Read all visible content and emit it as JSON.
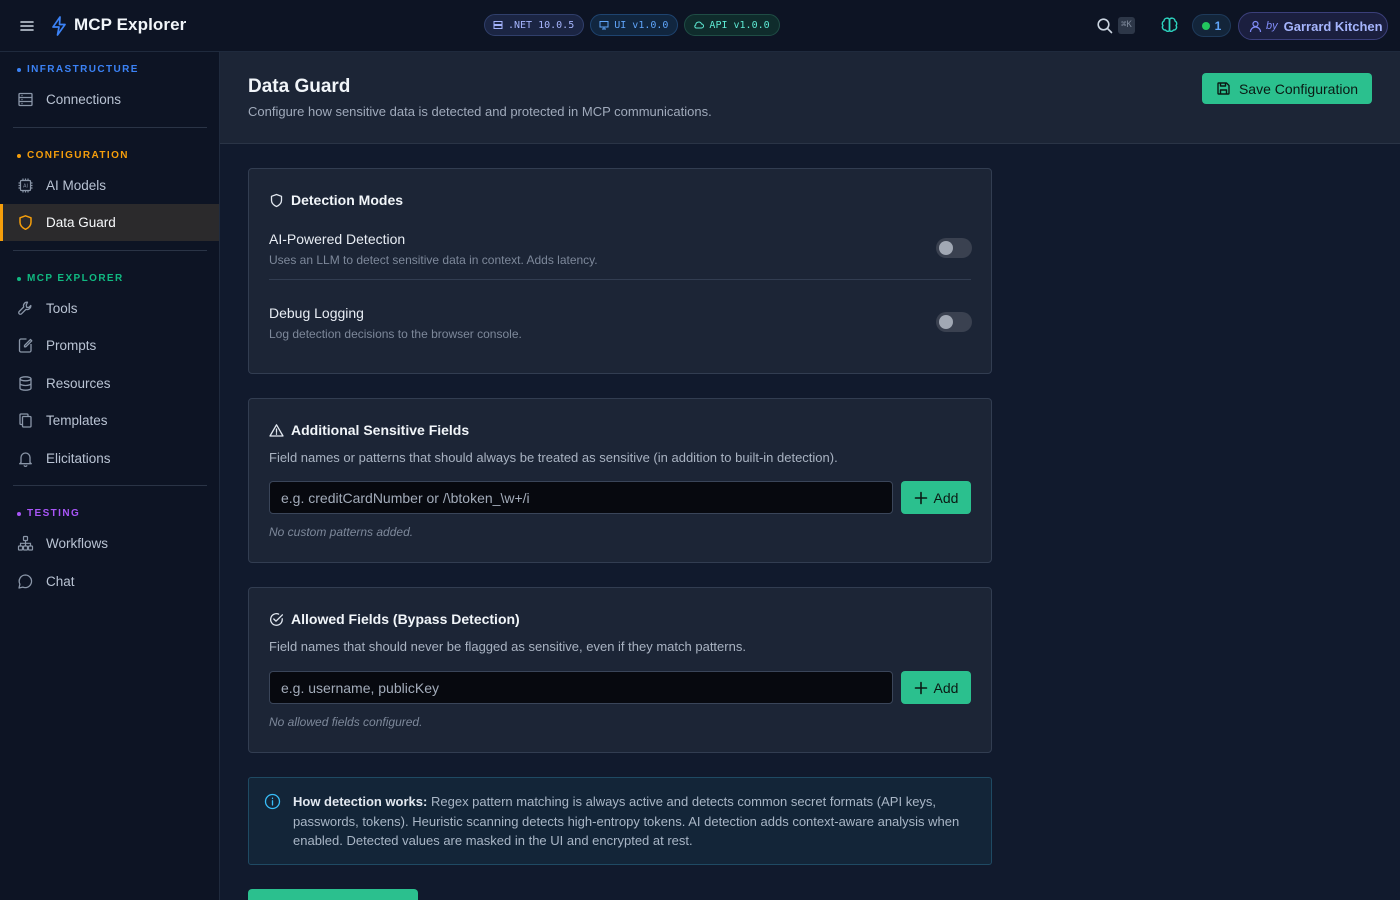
{
  "app": {
    "title": "MCP Explorer",
    "badges": [
      {
        "label": ".NET 10.0.5",
        "icon": "server-icon"
      },
      {
        "label": "UI v1.0.0",
        "icon": "monitor-icon"
      },
      {
        "label": "API v1.0.0",
        "icon": "cloud-icon"
      }
    ],
    "search_shortcut": "⌘K",
    "connection_count": "1",
    "user_prefix": "by",
    "user_name": "Garrard Kitchen"
  },
  "sidebar": {
    "sections": [
      {
        "label": "INFRASTRUCTURE",
        "color": "#3b82f6",
        "items": [
          {
            "label": "Connections",
            "icon": "server-rack-icon"
          }
        ]
      },
      {
        "label": "CONFIGURATION",
        "color": "#f59e0b",
        "items": [
          {
            "label": "AI Models",
            "icon": "chip-icon"
          },
          {
            "label": "Data Guard",
            "icon": "shield-icon",
            "active": true
          }
        ]
      },
      {
        "label": "MCP EXPLORER",
        "color": "#10b981",
        "items": [
          {
            "label": "Tools",
            "icon": "wrench-icon"
          },
          {
            "label": "Prompts",
            "icon": "pencil-note-icon"
          },
          {
            "label": "Resources",
            "icon": "database-icon"
          },
          {
            "label": "Templates",
            "icon": "copy-icon"
          },
          {
            "label": "Elicitations",
            "icon": "bell-icon"
          }
        ]
      },
      {
        "label": "TESTING",
        "color": "#a855f7",
        "items": [
          {
            "label": "Workflows",
            "icon": "workflow-icon"
          },
          {
            "label": "Chat",
            "icon": "chat-icon"
          }
        ]
      }
    ]
  },
  "page": {
    "title": "Data Guard",
    "subtitle": "Configure how sensitive data is detected and protected in MCP communications.",
    "save_label": "Save Configuration"
  },
  "detection": {
    "title": "Detection Modes",
    "modes": [
      {
        "title": "AI-Powered Detection",
        "description": "Uses an LLM to detect sensitive data in context. Adds latency.",
        "enabled": false
      },
      {
        "title": "Debug Logging",
        "description": "Log detection decisions to the browser console.",
        "enabled": false
      }
    ]
  },
  "sensitive_fields": {
    "title": "Additional Sensitive Fields",
    "description": "Field names or patterns that should always be treated as sensitive (in addition to built-in detection).",
    "placeholder": "e.g. creditCardNumber or /\\btoken_\\w+/i",
    "add_label": "Add",
    "empty_text": "No custom patterns added."
  },
  "allowed_fields": {
    "title": "Allowed Fields (Bypass Detection)",
    "description": "Field names that should never be flagged as sensitive, even if they match patterns.",
    "placeholder": "e.g. username, publicKey",
    "add_label": "Add",
    "empty_text": "No allowed fields configured."
  },
  "info": {
    "heading": "How detection works:",
    "body": "Regex pattern matching is always active and detects common secret formats (API keys, passwords, tokens). Heuristic scanning detects high-entropy tokens. AI detection adds context-aware analysis when enabled. Detected values are masked in the UI and encrypted at rest."
  }
}
